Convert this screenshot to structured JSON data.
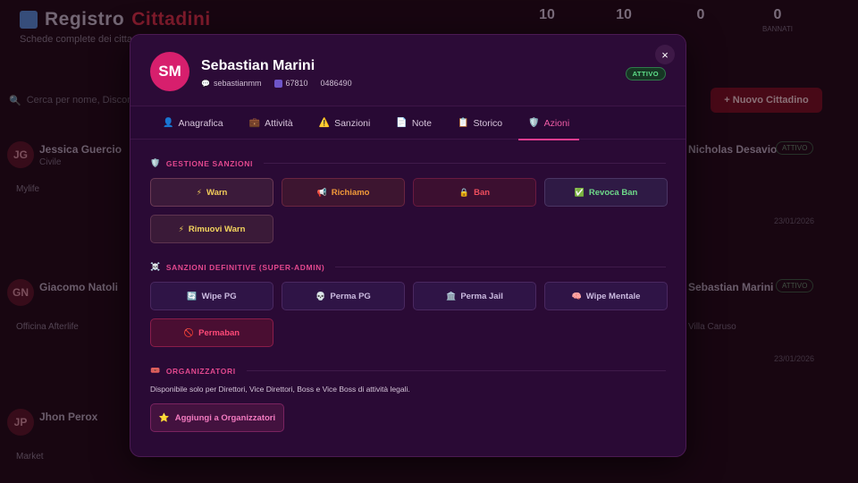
{
  "background": {
    "title_main": "Registro",
    "title_accent": "Cittadini",
    "subtitle": "Schede complete dei cittadini",
    "stats": [
      {
        "value": "10",
        "label": ""
      },
      {
        "value": "10",
        "label": ""
      },
      {
        "value": "0",
        "label": ""
      },
      {
        "value": "0",
        "label": "BANNATI"
      }
    ],
    "search_placeholder": "Cerca per nome, Discord...",
    "new_button": "+ Nuovo Cittadino",
    "cards_left": [
      {
        "initials": "JG",
        "name": "Jessica Guercio",
        "sub": "Civile",
        "footer": "Mylife"
      },
      {
        "initials": "GN",
        "name": "Giacomo Natoli",
        "sub": "",
        "footer": "Officina Afterlife"
      },
      {
        "initials": "JP",
        "name": "Jhon Perox",
        "sub": "",
        "footer": "Market"
      }
    ],
    "cards_right": [
      {
        "name": "Nicholas Desavio",
        "badge": "ATTIVO",
        "sub": "",
        "date": "23/01/2026"
      },
      {
        "name": "Sebastian Marini",
        "badge": "ATTIVO",
        "sub": "Villa Caruso",
        "date": "23/01/2026"
      }
    ]
  },
  "modal": {
    "initials": "SM",
    "name": "Sebastian Marini",
    "discord": "sebastianmm",
    "id_label": "ID",
    "id_value": "67810",
    "phone": "0486490",
    "status": "ATTIVO",
    "close_icon": "×",
    "tabs": [
      {
        "label": "Anagrafica",
        "icon": "👤",
        "active": false
      },
      {
        "label": "Attività",
        "icon": "💼",
        "active": false
      },
      {
        "label": "Sanzioni",
        "icon": "⚠️",
        "active": false
      },
      {
        "label": "Note",
        "icon": "📄",
        "active": false
      },
      {
        "label": "Storico",
        "icon": "📋",
        "active": false
      },
      {
        "label": "Azioni",
        "icon": "🛡️",
        "active": true
      }
    ],
    "sections": {
      "gestione": {
        "title": "GESTIONE SANZIONI",
        "icon": "🛡️",
        "buttons": [
          {
            "label": "Warn",
            "icon": "⚡"
          },
          {
            "label": "Richiamo",
            "icon": "📢"
          },
          {
            "label": "Ban",
            "icon": "🔒"
          },
          {
            "label": "Revoca Ban",
            "icon": "✅"
          },
          {
            "label": "Rimuovi Warn",
            "icon": "⚡"
          }
        ]
      },
      "definitive": {
        "title": "SANZIONI DEFINITIVE (SUPER-ADMIN)",
        "icon": "☠️",
        "buttons": [
          {
            "label": "Wipe PG",
            "icon": "🔄"
          },
          {
            "label": "Perma PG",
            "icon": "💀"
          },
          {
            "label": "Perma Jail",
            "icon": "🏛️"
          },
          {
            "label": "Wipe Mentale",
            "icon": "🧠"
          },
          {
            "label": "Permaban",
            "icon": "🚫"
          }
        ]
      },
      "organizzatori": {
        "title": "ORGANIZZATORI",
        "icon": "🎟️",
        "description": "Disponibile solo per Direttori, Vice Direttori, Boss e Vice Boss di attività legali.",
        "button": {
          "label": "Aggiungi a Organizzatori",
          "icon": "⭐"
        }
      }
    }
  }
}
